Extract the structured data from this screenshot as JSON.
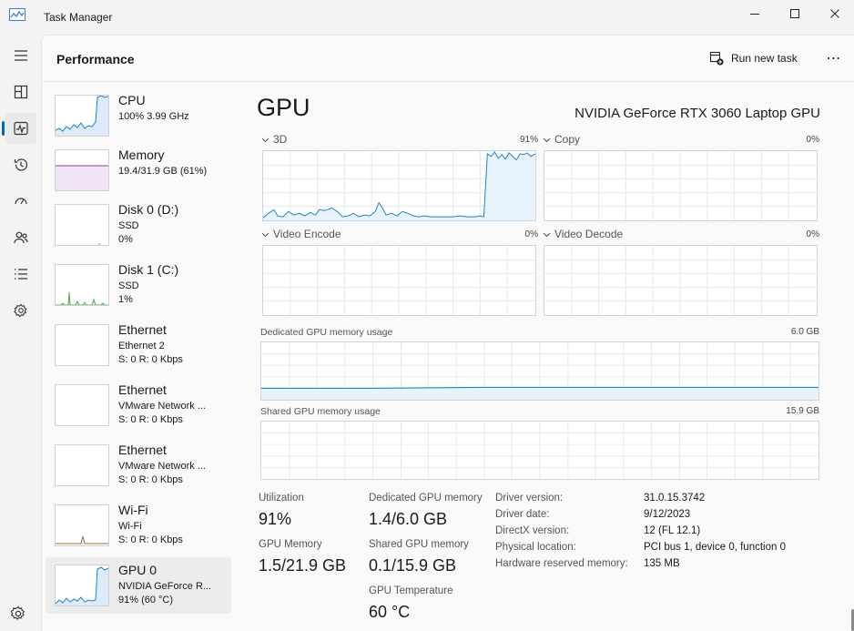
{
  "window": {
    "title": "Task Manager"
  },
  "page": {
    "title": "Performance",
    "run_new_task": "Run new task",
    "more": "⋯"
  },
  "nav_icons": [
    "hamburger-icon",
    "processes-icon",
    "performance-icon",
    "app-history-icon",
    "startup-apps-icon",
    "users-icon",
    "details-icon",
    "services-icon",
    "settings-icon"
  ],
  "devices": [
    {
      "name": "CPU",
      "line2": "100% 3.99 GHz",
      "line3": ""
    },
    {
      "name": "Memory",
      "line2": "19.4/31.9 GB (61%)",
      "line3": ""
    },
    {
      "name": "Disk 0 (D:)",
      "line2": "SSD",
      "line3": "0%"
    },
    {
      "name": "Disk 1 (C:)",
      "line2": "SSD",
      "line3": "1%"
    },
    {
      "name": "Ethernet",
      "line2": "Ethernet 2",
      "line3": "S: 0 R: 0 Kbps"
    },
    {
      "name": "Ethernet",
      "line2": "VMware Network ...",
      "line3": "S: 0 R: 0 Kbps"
    },
    {
      "name": "Ethernet",
      "line2": "VMware Network ...",
      "line3": "S: 0 R: 0 Kbps"
    },
    {
      "name": "Wi-Fi",
      "line2": "Wi-Fi",
      "line3": "S: 0 R: 0 Kbps"
    },
    {
      "name": "GPU 0",
      "line2": "NVIDIA GeForce R...",
      "line3": "91% (60 °C)"
    }
  ],
  "gpu": {
    "title": "GPU",
    "model": "NVIDIA GeForce RTX 3060 Laptop GPU",
    "engines": [
      {
        "label": "3D",
        "pct": "91%"
      },
      {
        "label": "Copy",
        "pct": "0%"
      },
      {
        "label": "Video Encode",
        "pct": "0%"
      },
      {
        "label": "Video Decode",
        "pct": "0%"
      }
    ],
    "dedicated_mem": {
      "label": "Dedicated GPU memory usage",
      "max": "6.0 GB"
    },
    "shared_mem": {
      "label": "Shared GPU memory usage",
      "max": "15.9 GB"
    },
    "stats": {
      "utilization": {
        "label": "Utilization",
        "value": "91%"
      },
      "dedicated": {
        "label": "Dedicated GPU memory",
        "value": "1.4/6.0 GB"
      },
      "gpu_memory": {
        "label": "GPU Memory",
        "value": "1.5/21.9 GB"
      },
      "shared": {
        "label": "Shared GPU memory",
        "value": "0.1/15.9 GB"
      },
      "temperature": {
        "label": "GPU Temperature",
        "value": "60 °C"
      }
    },
    "properties": [
      {
        "key": "Driver version:",
        "value": "31.0.15.3742"
      },
      {
        "key": "Driver date:",
        "value": "9/12/2023"
      },
      {
        "key": "DirectX version:",
        "value": "12 (FL 12.1)"
      },
      {
        "key": "Physical location:",
        "value": "PCI bus 1, device 0, function 0"
      },
      {
        "key": "Hardware reserved memory:",
        "value": "135 MB"
      }
    ]
  },
  "colors": {
    "cpu": "#1a86c6",
    "memory": "#8b3d9e",
    "disk": "#4caf50",
    "wifi": "#a0652d",
    "gpu": "#1a86c6",
    "accent": "#0067c0"
  }
}
